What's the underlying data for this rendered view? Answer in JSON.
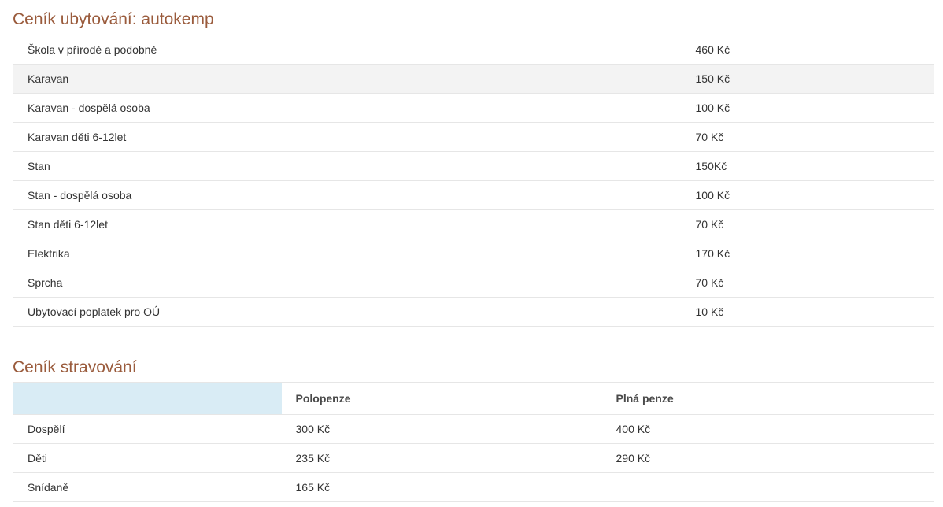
{
  "accommodation": {
    "title": "Ceník ubytování: autokemp",
    "rows": [
      {
        "item": "Škola v přírodě a podobně",
        "price": "460 Kč"
      },
      {
        "item": "Karavan",
        "price": "150 Kč"
      },
      {
        "item": "Karavan - dospělá osoba",
        "price": "100 Kč"
      },
      {
        "item": "Karavan děti 6-12let",
        "price": "70 Kč"
      },
      {
        "item": "Stan",
        "price": "150Kč"
      },
      {
        "item": "Stan - dospělá osoba",
        "price": "100 Kč"
      },
      {
        "item": "Stan děti 6-12let",
        "price": "70 Kč"
      },
      {
        "item": "Elektrika",
        "price": "170 Kč"
      },
      {
        "item": "Sprcha",
        "price": "70 Kč"
      },
      {
        "item": "Ubytovací poplatek pro OÚ",
        "price": "10 Kč"
      }
    ]
  },
  "food": {
    "title": "Ceník stravování",
    "headers": [
      "",
      "Polopenze",
      "Plná penze"
    ],
    "rows": [
      {
        "label": "Dospělí",
        "half": "300 Kč",
        "full": "400 Kč"
      },
      {
        "label": "Děti",
        "half": "235 Kč",
        "full": "290 Kč"
      },
      {
        "label": "Snídaně",
        "half": "165 Kč",
        "full": ""
      }
    ]
  },
  "colors": {
    "heading": "#9a5b3c",
    "striped_row": "#f3f3f3",
    "header_corner": "#d9ecf5",
    "border": "#e6e6e6"
  }
}
